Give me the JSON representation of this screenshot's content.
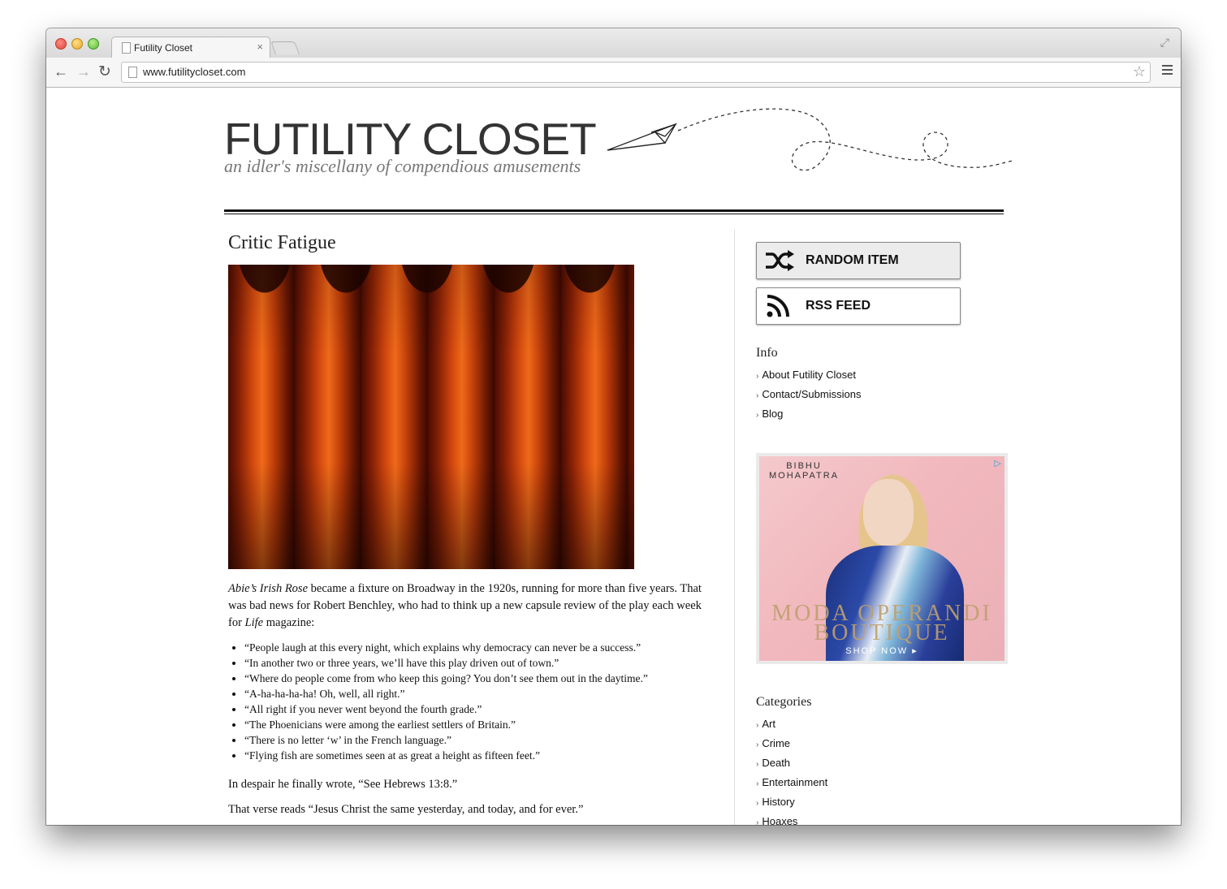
{
  "browser": {
    "tab_title": "Futility Closet",
    "tab_close": "×",
    "url": "www.futilitycloset.com",
    "back_glyph": "←",
    "forward_glyph": "→",
    "reload_glyph": "↻",
    "star_glyph": "☆",
    "fullscreen_glyph": "⤢",
    "icons": [
      "page-icon",
      "back-arrow-icon",
      "forward-arrow-icon",
      "reload-icon",
      "bookmark-star-icon",
      "menu-icon",
      "fullscreen-icon"
    ]
  },
  "site": {
    "title": "FUTILITY CLOSET",
    "tagline": "an idler's miscellany of compendious amusements"
  },
  "post": {
    "title": "Critic Fatigue",
    "intro_italic": "Abie’s Irish Rose",
    "intro_text_1": " became a fixture on Broadway in the 1920s, running for more than five years. That was bad news for Robert Benchley, who had to think up a new capsule review of the play each week for ",
    "intro_italic_2": "Life",
    "intro_text_2": " magazine:",
    "quotes": [
      "“People laugh at this every night, which explains why democracy can never be a success.”",
      "“In another two or three years, we’ll have this play driven out of town.”",
      "“Where do people come from who keep this going? You don’t see them out in the daytime.”",
      "“A-ha-ha-ha-ha! Oh, well, all right.”",
      "“All right if you never went beyond the fourth grade.”",
      "“The Phoenicians were among the earliest settlers of Britain.”",
      "“There is no letter ‘w’ in the French language.”",
      "“Flying fish are sometimes seen at as great a height as fifteen feet.”"
    ],
    "closing_1": "In despair he finally wrote, “See Hebrews 13:8.”",
    "closing_2": "That verse reads “Jesus Christ the same yesterday, and today, and for ever.”"
  },
  "sidebar": {
    "random_label": "RANDOM ITEM",
    "rss_label": "RSS FEED",
    "info_heading": "Info",
    "info_links": [
      "About Futility Closet",
      "Contact/Submissions",
      "Blog"
    ],
    "categories_heading": "Categories",
    "categories": [
      "Art",
      "Crime",
      "Death",
      "Entertainment",
      "History",
      "Hoaxes"
    ],
    "chevron": "›"
  },
  "ad": {
    "brand_line_1": "BIBHU",
    "brand_line_2": "MOHAPATRA",
    "title_line_1": "MODA OPERANDI",
    "title_line_2": "BOUTIQUE",
    "cta": "SHOP NOW ▸",
    "choice_glyph": "▷"
  },
  "colors": {
    "accent": "#111111",
    "ad_background": "#f1b8bd"
  }
}
